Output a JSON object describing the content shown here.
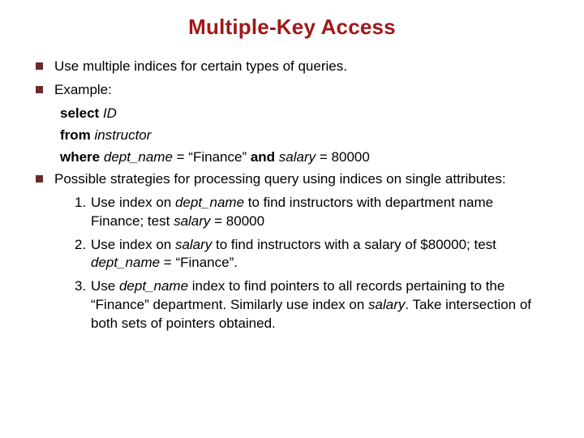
{
  "title": "Multiple-Key Access",
  "bullets": {
    "b1": "Use multiple indices for certain types of queries.",
    "b2": "Example:",
    "sql": {
      "select_kw": "select ",
      "select_col": "ID",
      "from_kw": "from ",
      "from_tbl": "instructor",
      "where_kw": "where ",
      "cond_col1": "dept_name",
      "cond_eq1": " = “Finance” ",
      "and_kw": "and  ",
      "cond_col2": "salary",
      "cond_eq2": " = 80000"
    },
    "b3": "Possible strategies for processing query using indices on single attributes:",
    "items": {
      "n1": "1.",
      "n2": "2.",
      "n3": "3.",
      "i1a": "Use index on ",
      "i1b": "dept_name",
      "i1c": " to find instructors with department name Finance; test ",
      "i1d": "salary",
      "i1e": " = 80000",
      "i2a": "Use index on ",
      "i2b": "salary",
      "i2c": " to find instructors with a salary of $80000; test ",
      "i2d": "dept_name",
      "i2e": " = “Finance”.",
      "i3a": "Use ",
      "i3b": "dept_name",
      "i3c": " index to find pointers to all records pertaining to the “Finance” department.  Similarly use index on ",
      "i3d": "salary",
      "i3e": ".  Take intersection of both sets of pointers obtained."
    }
  }
}
